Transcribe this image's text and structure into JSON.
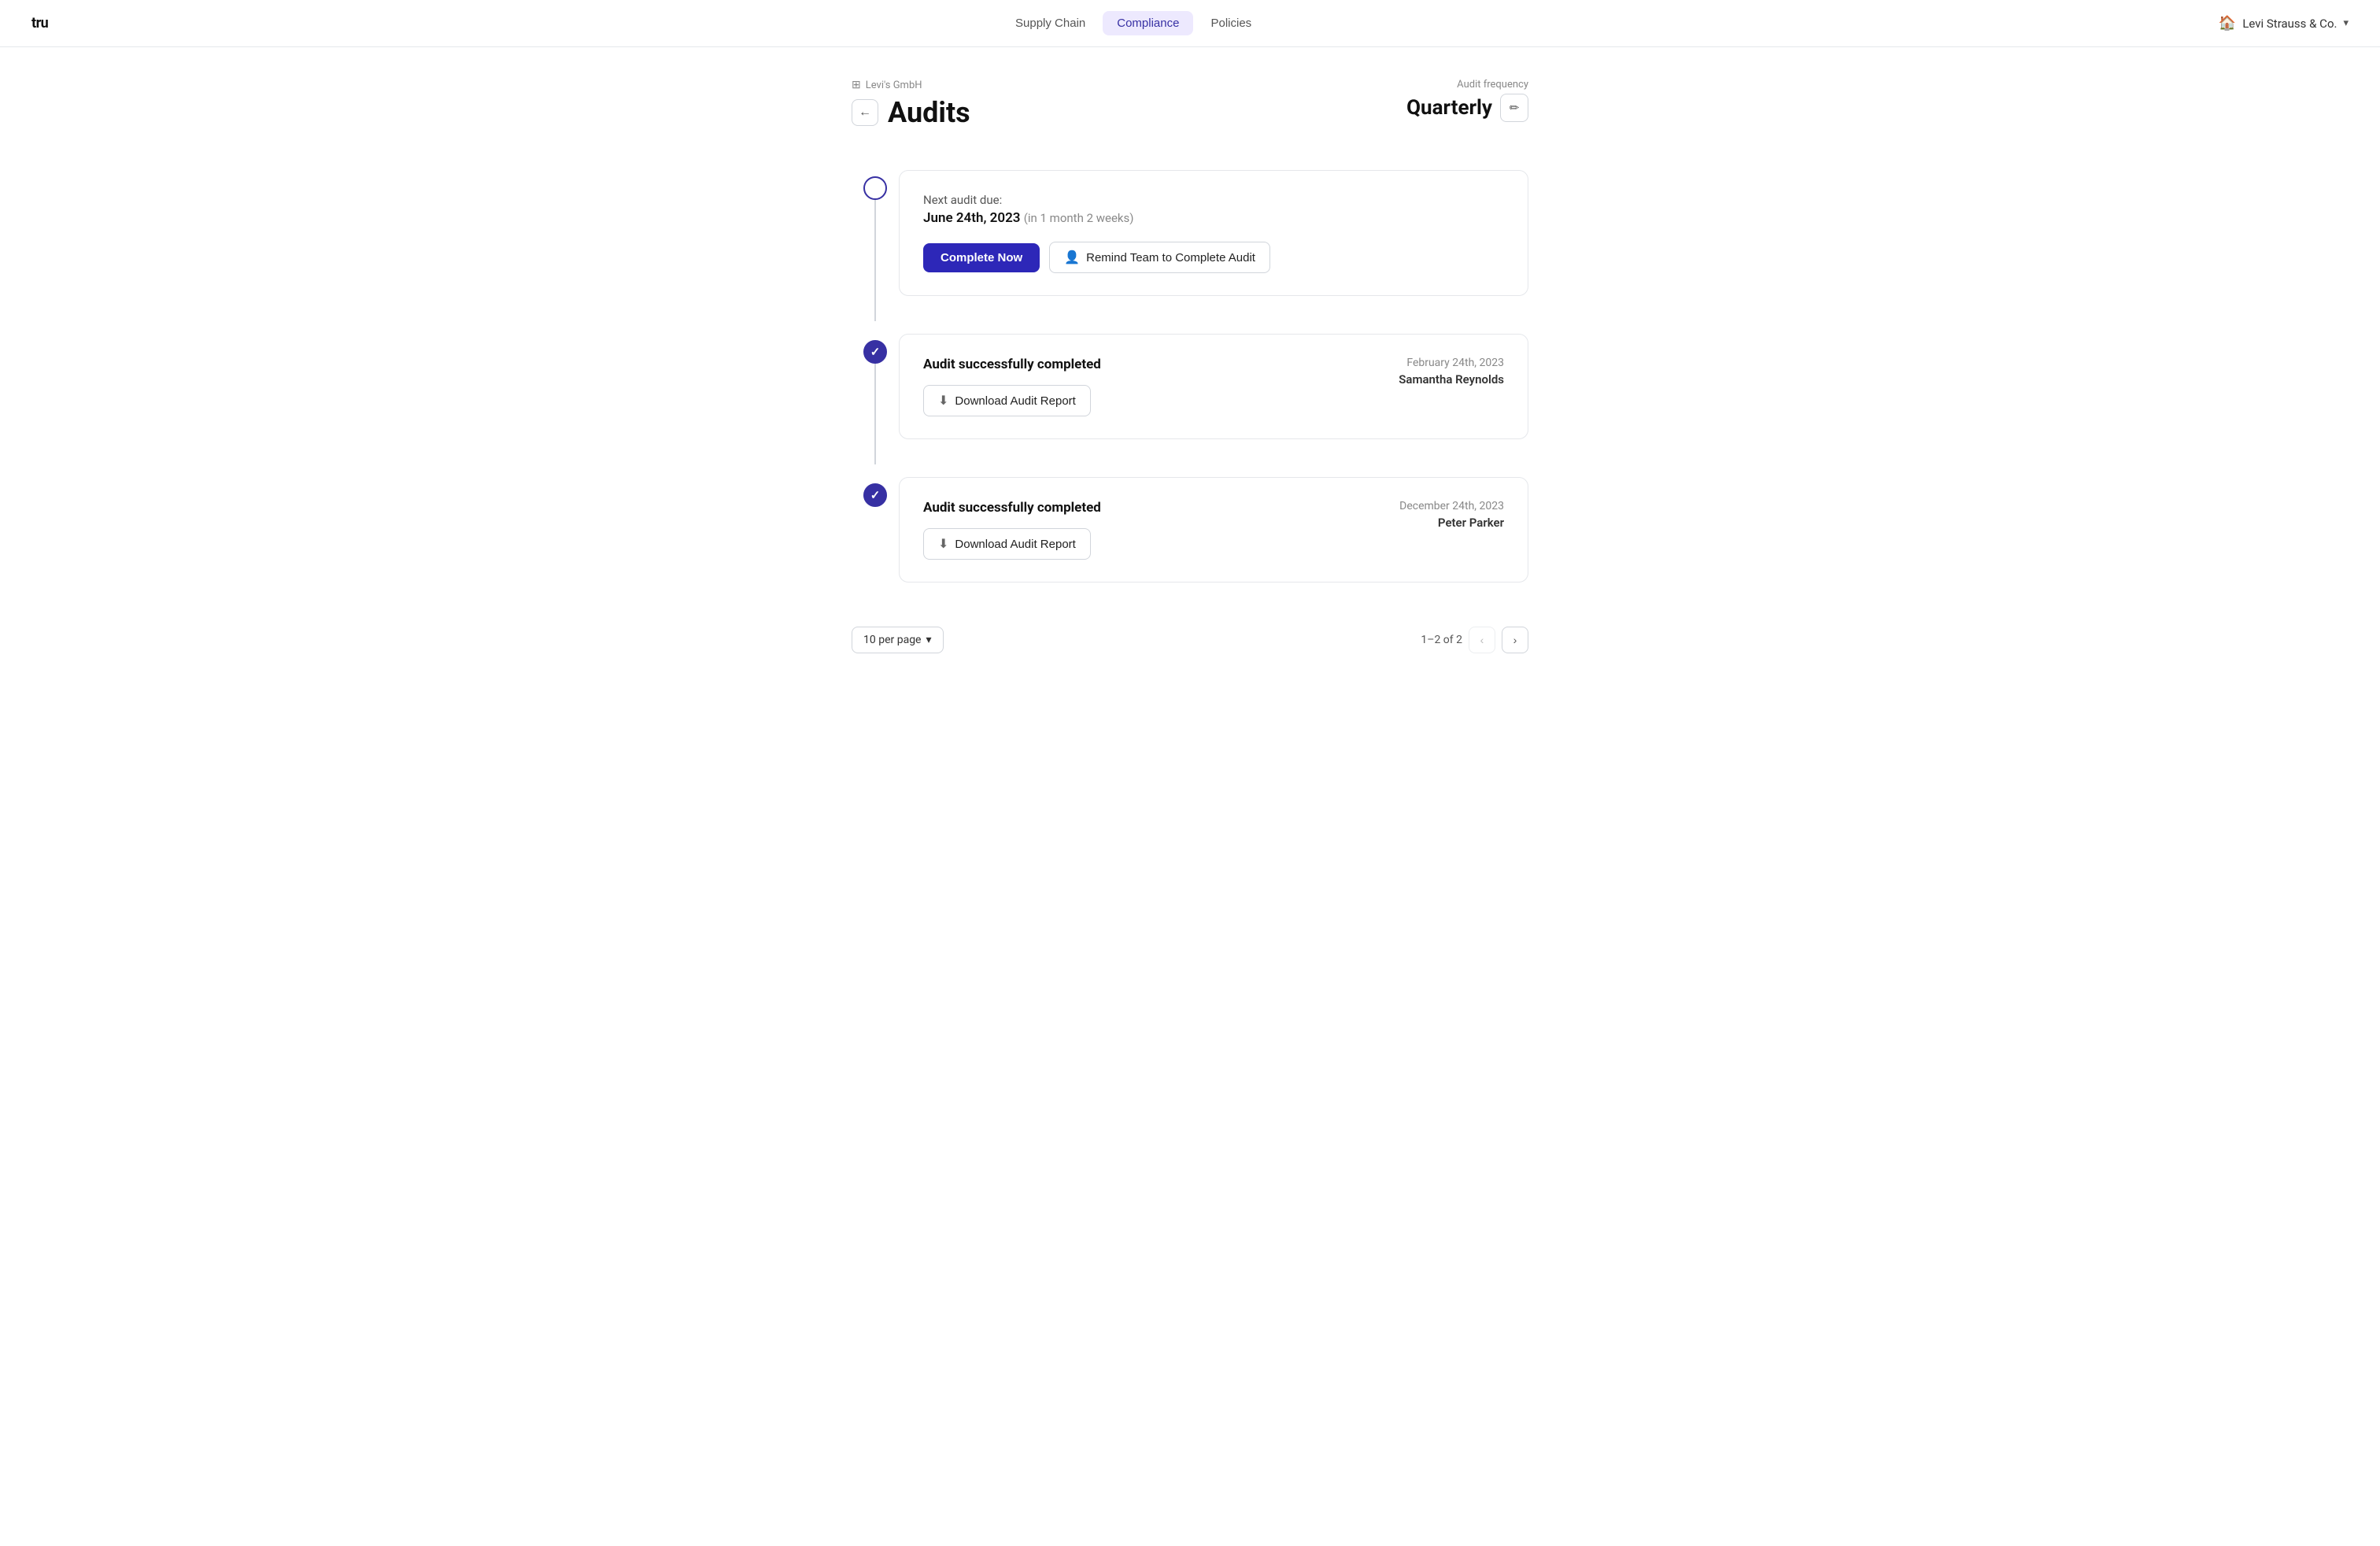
{
  "header": {
    "logo": "tru",
    "nav": [
      {
        "id": "supply-chain",
        "label": "Supply Chain",
        "active": false
      },
      {
        "id": "compliance",
        "label": "Compliance",
        "active": true
      },
      {
        "id": "policies",
        "label": "Policies",
        "active": false
      }
    ],
    "company_icon": "🏠",
    "company_name": "Levi Strauss & Co.",
    "chevron": "▾"
  },
  "breadcrumb": {
    "icon": "⊞",
    "text": "Levi's GmbH"
  },
  "page": {
    "back_arrow": "←",
    "title": "Audits",
    "audit_frequency_label": "Audit frequency",
    "audit_frequency_value": "Quarterly",
    "edit_icon": "✏"
  },
  "timeline": {
    "entries": [
      {
        "id": "next-audit",
        "type": "pending",
        "next_audit_label": "Next audit due:",
        "next_audit_date": "June 24th, 2023",
        "next_audit_relative": "(in 1 month 2 weeks)",
        "complete_now_label": "Complete Now",
        "remind_team_label": "Remind Team to Complete Audit",
        "remind_icon": "👤"
      },
      {
        "id": "audit-1",
        "type": "completed",
        "completed_label": "Audit successfully completed",
        "download_label": "Download Audit Report",
        "download_icon": "⬇",
        "date": "February 24th, 2023",
        "user": "Samantha Reynolds"
      },
      {
        "id": "audit-2",
        "type": "completed",
        "completed_label": "Audit successfully completed",
        "download_label": "Download Audit Report",
        "download_icon": "⬇",
        "date": "December 24th, 2023",
        "user": "Peter Parker"
      }
    ]
  },
  "pagination": {
    "per_page_label": "10 per page",
    "chevron": "▾",
    "range": "1–2 of 2",
    "prev_icon": "‹",
    "next_icon": "›"
  }
}
